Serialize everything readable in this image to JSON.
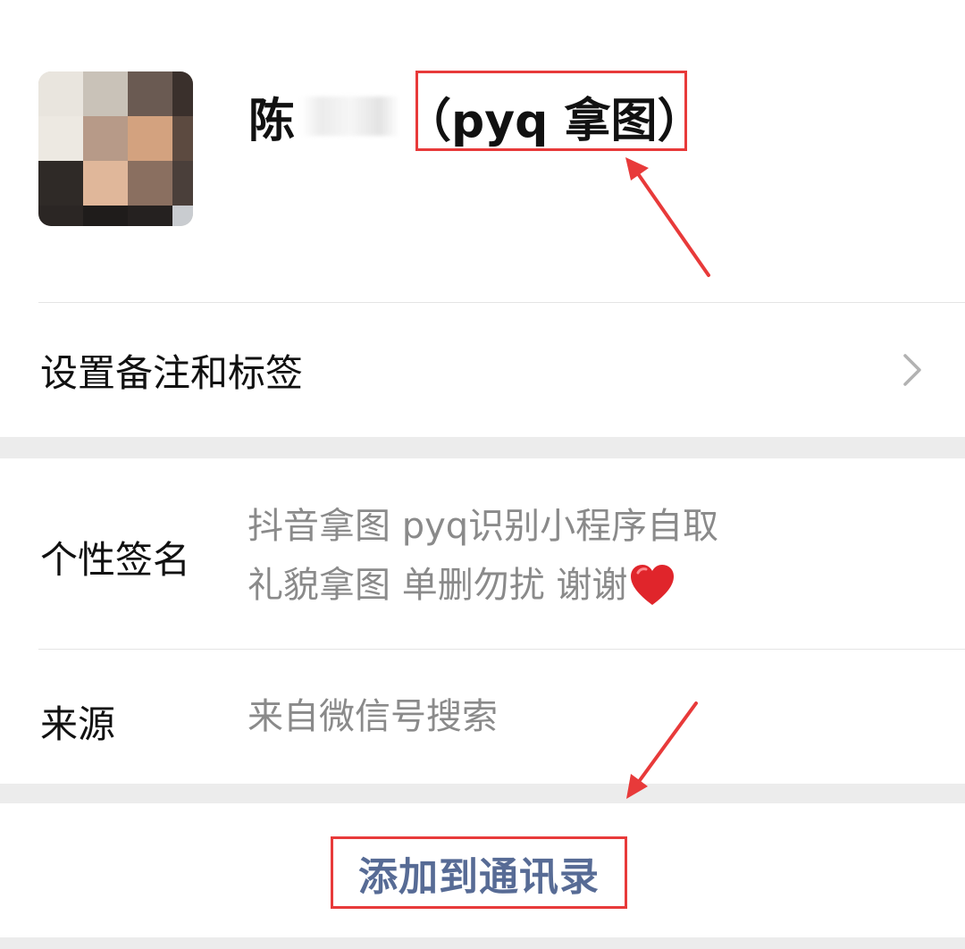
{
  "profile": {
    "name_visible_prefix": "陈",
    "name_suffix": "（pyq 拿图）",
    "avatar_icon": "user-avatar-pixelated"
  },
  "remark": {
    "label": "设置备注和标签",
    "chevron_icon": "chevron-right-icon"
  },
  "info": {
    "signature_label": "个性签名",
    "signature_line1": "抖音拿图 pyq识别小程序自取",
    "signature_line2": "礼貌拿图 单删勿扰 谢谢",
    "signature_emoji": "red-heart-emoji",
    "source_label": "来源",
    "source_value": "来自微信号搜索"
  },
  "actions": {
    "add_contact_label": "添加到通讯录"
  },
  "colors": {
    "annotation_red": "#e83a3a",
    "link_blue": "#576b95",
    "secondary_text": "#8a8a8a",
    "section_gap": "#ececec"
  }
}
